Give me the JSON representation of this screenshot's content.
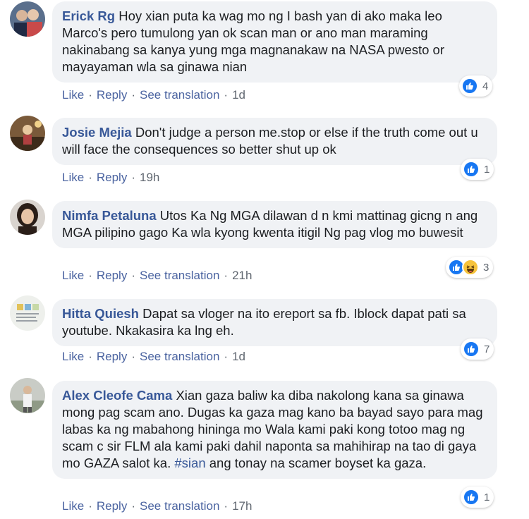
{
  "actions": {
    "like": "Like",
    "reply": "Reply",
    "see_translation": "See translation",
    "separator": "·"
  },
  "colors": {
    "author": "#385898",
    "bubble": "#f0f2f5",
    "like_blue": "#1877f2",
    "haha_yellow": "#f7c33b"
  },
  "comments": [
    {
      "author": "Erick Rg",
      "text": "Hoy xian puta ka wag mo ng I bash yan di ako maka leo Marco's pero tumulong yan ok scan man or ano man maraming nakinabang sa kanya yung mga magnanakaw na NASA pwesto or mayayaman wla sa ginawa nian",
      "time": "1d",
      "reactions": [
        "like-icon"
      ],
      "reaction_count": "4"
    },
    {
      "author": "Josie Mejia",
      "text": "Don't judge a person me.stop or else if the truth come out u will face the consequences so better shut up ok",
      "time": "19h",
      "reactions": [
        "like-icon"
      ],
      "reaction_count": "1"
    },
    {
      "author": "Nimfa Petaluna",
      "text": "Utos Ka Ng MGA dilawan d n kmi mattinag gicng n ang MGA pilipino gago Ka wla kyong kwenta itigil Ng pag vlog mo buwesit",
      "time": "21h",
      "reactions": [
        "like-icon",
        "haha-icon"
      ],
      "reaction_count": "3"
    },
    {
      "author": "Hitta Quiesh",
      "text": "Dapat sa vloger na ito ereport sa fb. Iblock dapat pati sa youtube. Nkakasira ka lng eh.",
      "time": "1d",
      "reactions": [
        "like-icon"
      ],
      "reaction_count": "7"
    },
    {
      "author": "Alex Cleofe Cama",
      "text": "Xian gaza baliw ka diba nakolong kana sa ginawa mong pag scam ano. Dugas ka gaza mag kano ba bayad sayo para mag labas ka ng mabahong hininga mo Wala kami paki kong totoo mag ng scam c sir FLM ala kami paki dahil naponta sa mahihirap na tao di gaya mo GAZA salot ka.",
      "hashtag": "#sian",
      "text_after": "ang tonay na scamer boyset ka gaza.",
      "time": "17h",
      "reactions": [
        "like-icon"
      ],
      "reaction_count": "1"
    }
  ]
}
